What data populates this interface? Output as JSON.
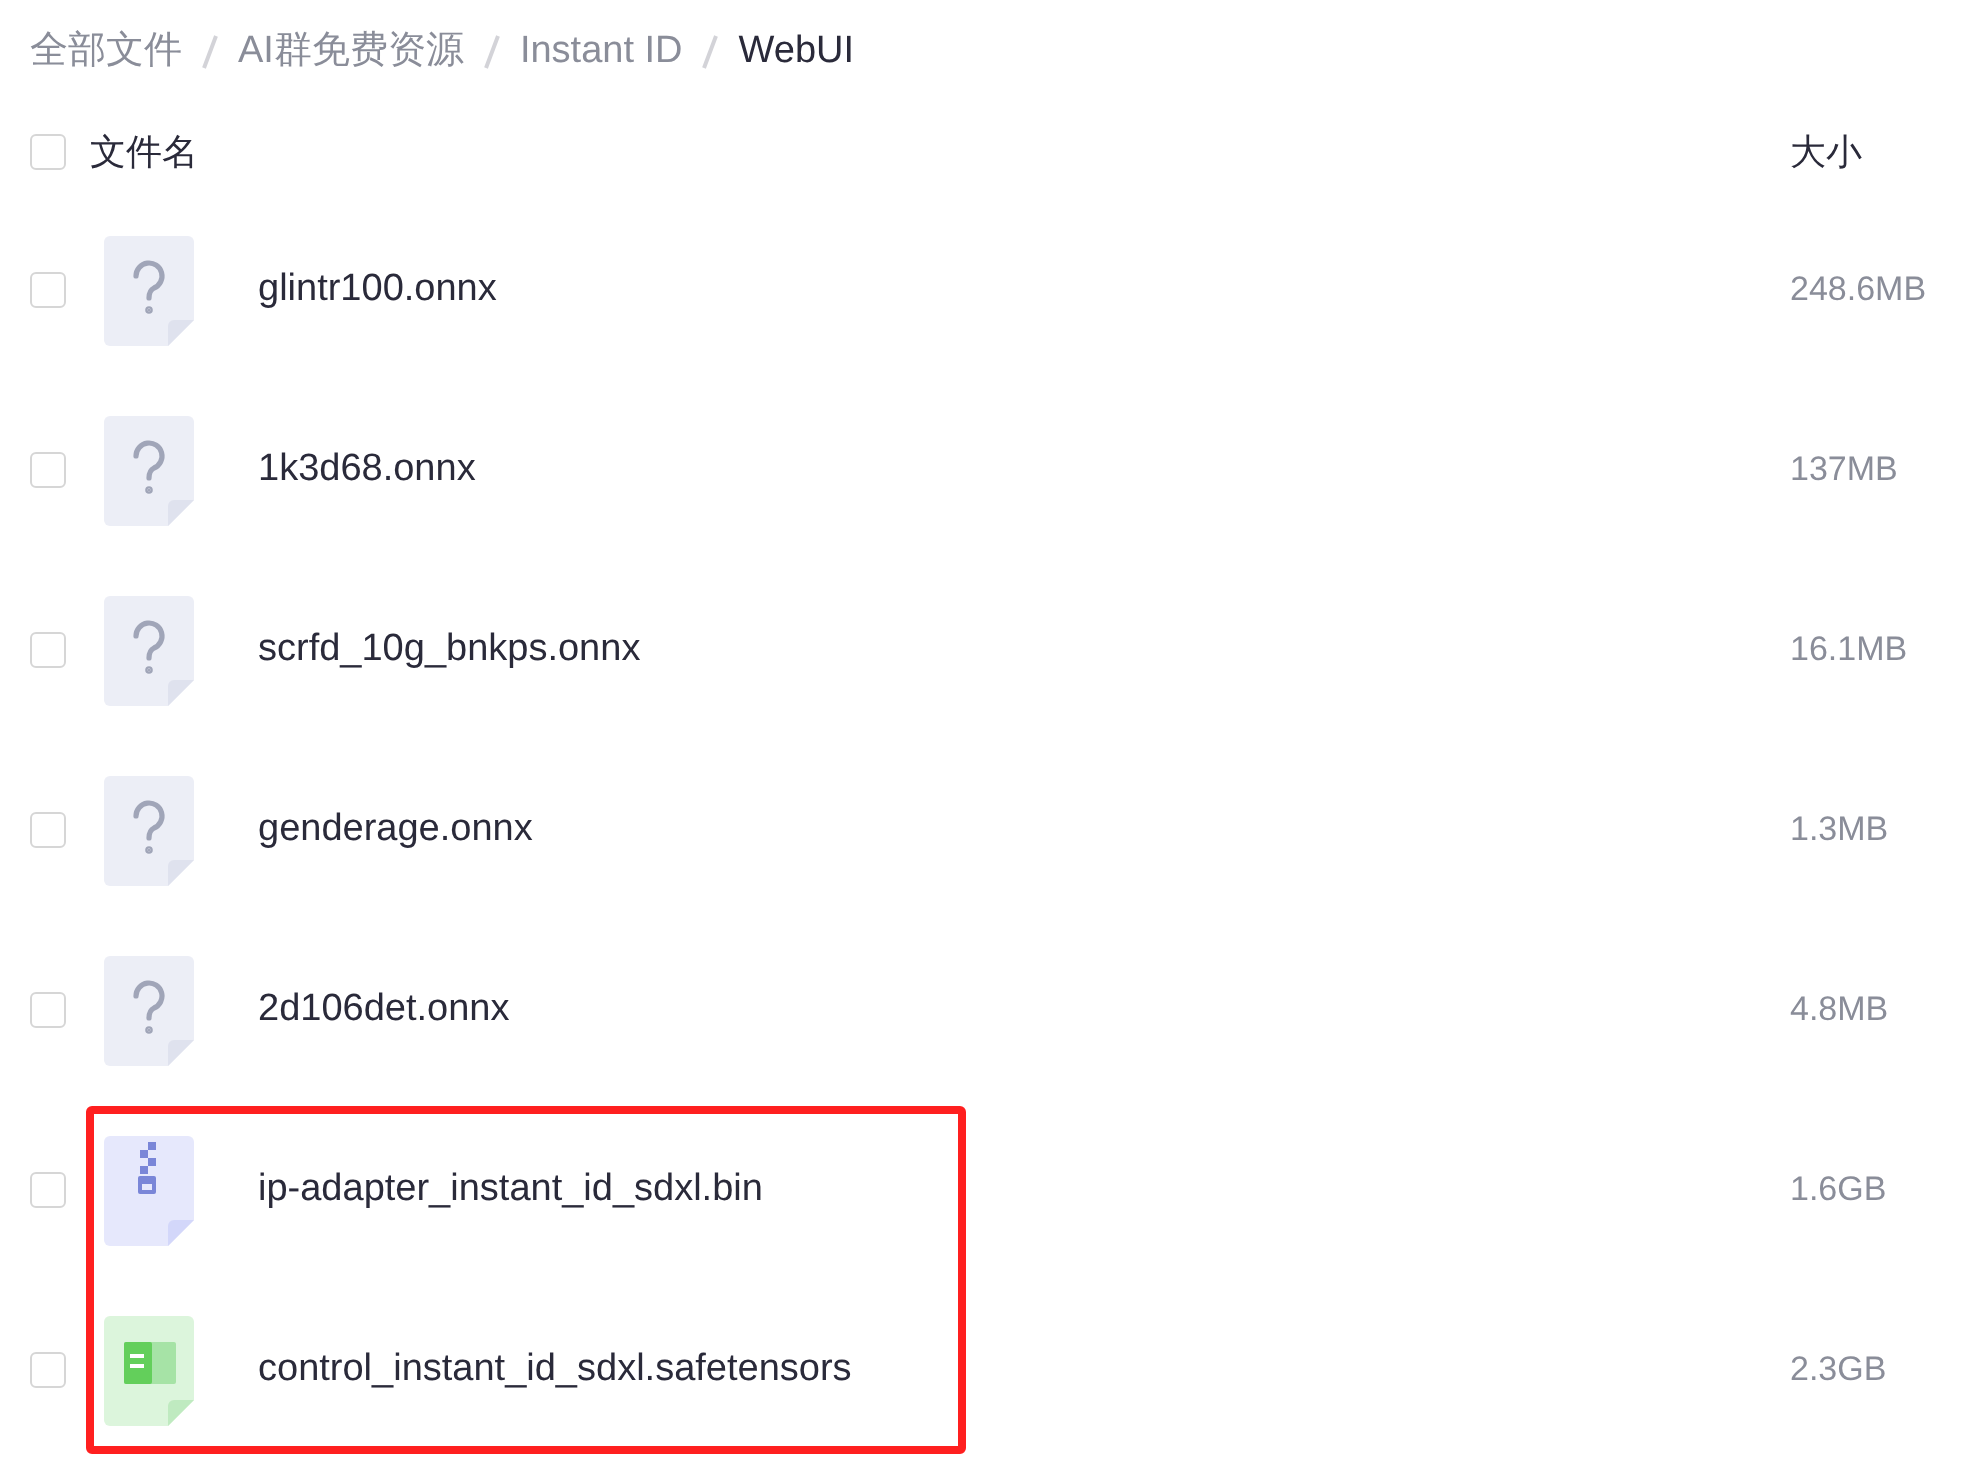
{
  "breadcrumb": [
    {
      "label": "全部文件",
      "current": false
    },
    {
      "label": "AI群免费资源",
      "current": false
    },
    {
      "label": "Instant ID",
      "current": false
    },
    {
      "label": "WebUI",
      "current": true
    }
  ],
  "table": {
    "select_all": {
      "checked": false
    },
    "columns": [
      "文件名",
      "大小"
    ],
    "rows": [
      {
        "kind": "unknown",
        "name": "glintr100.onnx",
        "size": "248.6MB",
        "checked": false,
        "highlighted": false
      },
      {
        "kind": "unknown",
        "name": "1k3d68.onnx",
        "size": "137MB",
        "checked": false,
        "highlighted": false
      },
      {
        "kind": "unknown",
        "name": "scrfd_10g_bnkps.onnx",
        "size": "16.1MB",
        "checked": false,
        "highlighted": false
      },
      {
        "kind": "unknown",
        "name": "genderage.onnx",
        "size": "1.3MB",
        "checked": false,
        "highlighted": false
      },
      {
        "kind": "unknown",
        "name": "2d106det.onnx",
        "size": "4.8MB",
        "checked": false,
        "highlighted": false
      },
      {
        "kind": "archive",
        "name": "ip-adapter_instant_id_sdxl.bin",
        "size": "1.6GB",
        "checked": false,
        "highlighted": true
      },
      {
        "kind": "document",
        "name": "control_instant_id_sdxl.safetensors",
        "size": "2.3GB",
        "checked": false,
        "highlighted": true
      }
    ]
  }
}
